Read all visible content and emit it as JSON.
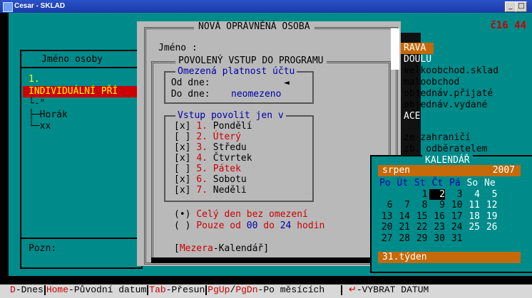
{
  "window": {
    "title": "Cesar - SKLAD"
  },
  "clock": "č16 44",
  "left_panel": {
    "header": "Jméno osoby",
    "tree": [
      "1.",
      "INDIVIDUÁLNÍ PŘÍ",
      "-\"",
      "Horák",
      "xx"
    ],
    "note_label": "Pozn:"
  },
  "right_menu": [
    "RAVA",
    "DOULU",
    "velkoobchod.sklad",
    "maloobchod",
    "objednáv.přijaté",
    "objednáv.vydané",
    "ACE",
    "ze zahraničí",
    "zb. odběratelem"
  ],
  "dialog": {
    "title": "NOVÁ OPRÁVNĚNÁ OSOBA",
    "name_label": "Jméno   :",
    "access_title": "POVOLENÝ VSTUP DO PROGRAMU",
    "validity_title": "Omezená platnost účtu",
    "from_label": "Od dne:",
    "from_value": "◄",
    "to_label": "Do dne:",
    "to_value": "neomezeno",
    "days_title": "Vstup povolit jen v",
    "days": [
      {
        "check": "[x]",
        "num": "1.",
        "name": "Pondělí"
      },
      {
        "check": "[ ]",
        "num": "2.",
        "name": "Úterý"
      },
      {
        "check": "[x]",
        "num": "3.",
        "name": "Středu"
      },
      {
        "check": "[x]",
        "num": "4.",
        "name": "Čtvrtek"
      },
      {
        "check": "[ ]",
        "num": "5.",
        "name": "Pátek"
      },
      {
        "check": "[x]",
        "num": "6.",
        "name": "Sobotu"
      },
      {
        "check": "[x]",
        "num": "7.",
        "name": "Neděli"
      }
    ],
    "opt1_mark": "(•)",
    "opt1_text": "Celý den bez omezení",
    "opt2_mark": "( )",
    "opt2_pre": "Pouze od",
    "opt2_from": "00",
    "opt2_mid": "do",
    "opt2_to": "24",
    "opt2_post": "hodin",
    "bottom_key": "Mezera",
    "bottom_text": "-Kalendář"
  },
  "calendar": {
    "title": "KALENDÁŘ",
    "month": "srpen",
    "year": "2007",
    "weekdays": [
      "Po",
      "Út",
      "St",
      "Čt",
      "Pá",
      "So",
      "Ne"
    ],
    "weeks": [
      [
        "",
        "",
        "1",
        "2",
        "3",
        "4",
        "5"
      ],
      [
        "6",
        "7",
        "8",
        "9",
        "10",
        "11",
        "12"
      ],
      [
        "13",
        "14",
        "15",
        "16",
        "17",
        "18",
        "19"
      ],
      [
        "20",
        "21",
        "22",
        "23",
        "24",
        "25",
        "26"
      ],
      [
        "27",
        "28",
        "29",
        "30",
        "31",
        "",
        ""
      ]
    ],
    "selected_day": "2",
    "week_label": "31.týden"
  },
  "footer": {
    "k1": "D",
    "t1": "-Dnes",
    "k2": "Home",
    "t2": "-Původní datum",
    "k3": "Tab",
    "t3": "-Přesun",
    "k4": "PgUp",
    "k4b": "PgDn",
    "t4": "-Po měsících",
    "k5": "↵",
    "t5": "-VYBRAT DATUM"
  }
}
